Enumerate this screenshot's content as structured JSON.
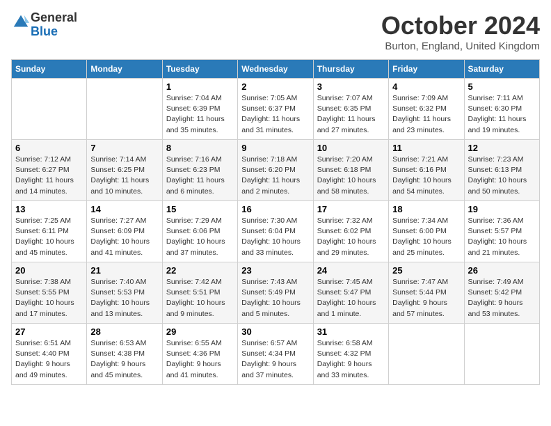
{
  "header": {
    "logo_line1": "General",
    "logo_line2": "Blue",
    "month": "October 2024",
    "location": "Burton, England, United Kingdom"
  },
  "days_of_week": [
    "Sunday",
    "Monday",
    "Tuesday",
    "Wednesday",
    "Thursday",
    "Friday",
    "Saturday"
  ],
  "weeks": [
    [
      {
        "day": "",
        "info": ""
      },
      {
        "day": "",
        "info": ""
      },
      {
        "day": "1",
        "info": "Sunrise: 7:04 AM\nSunset: 6:39 PM\nDaylight: 11 hours and 35 minutes."
      },
      {
        "day": "2",
        "info": "Sunrise: 7:05 AM\nSunset: 6:37 PM\nDaylight: 11 hours and 31 minutes."
      },
      {
        "day": "3",
        "info": "Sunrise: 7:07 AM\nSunset: 6:35 PM\nDaylight: 11 hours and 27 minutes."
      },
      {
        "day": "4",
        "info": "Sunrise: 7:09 AM\nSunset: 6:32 PM\nDaylight: 11 hours and 23 minutes."
      },
      {
        "day": "5",
        "info": "Sunrise: 7:11 AM\nSunset: 6:30 PM\nDaylight: 11 hours and 19 minutes."
      }
    ],
    [
      {
        "day": "6",
        "info": "Sunrise: 7:12 AM\nSunset: 6:27 PM\nDaylight: 11 hours and 14 minutes."
      },
      {
        "day": "7",
        "info": "Sunrise: 7:14 AM\nSunset: 6:25 PM\nDaylight: 11 hours and 10 minutes."
      },
      {
        "day": "8",
        "info": "Sunrise: 7:16 AM\nSunset: 6:23 PM\nDaylight: 11 hours and 6 minutes."
      },
      {
        "day": "9",
        "info": "Sunrise: 7:18 AM\nSunset: 6:20 PM\nDaylight: 11 hours and 2 minutes."
      },
      {
        "day": "10",
        "info": "Sunrise: 7:20 AM\nSunset: 6:18 PM\nDaylight: 10 hours and 58 minutes."
      },
      {
        "day": "11",
        "info": "Sunrise: 7:21 AM\nSunset: 6:16 PM\nDaylight: 10 hours and 54 minutes."
      },
      {
        "day": "12",
        "info": "Sunrise: 7:23 AM\nSunset: 6:13 PM\nDaylight: 10 hours and 50 minutes."
      }
    ],
    [
      {
        "day": "13",
        "info": "Sunrise: 7:25 AM\nSunset: 6:11 PM\nDaylight: 10 hours and 45 minutes."
      },
      {
        "day": "14",
        "info": "Sunrise: 7:27 AM\nSunset: 6:09 PM\nDaylight: 10 hours and 41 minutes."
      },
      {
        "day": "15",
        "info": "Sunrise: 7:29 AM\nSunset: 6:06 PM\nDaylight: 10 hours and 37 minutes."
      },
      {
        "day": "16",
        "info": "Sunrise: 7:30 AM\nSunset: 6:04 PM\nDaylight: 10 hours and 33 minutes."
      },
      {
        "day": "17",
        "info": "Sunrise: 7:32 AM\nSunset: 6:02 PM\nDaylight: 10 hours and 29 minutes."
      },
      {
        "day": "18",
        "info": "Sunrise: 7:34 AM\nSunset: 6:00 PM\nDaylight: 10 hours and 25 minutes."
      },
      {
        "day": "19",
        "info": "Sunrise: 7:36 AM\nSunset: 5:57 PM\nDaylight: 10 hours and 21 minutes."
      }
    ],
    [
      {
        "day": "20",
        "info": "Sunrise: 7:38 AM\nSunset: 5:55 PM\nDaylight: 10 hours and 17 minutes."
      },
      {
        "day": "21",
        "info": "Sunrise: 7:40 AM\nSunset: 5:53 PM\nDaylight: 10 hours and 13 minutes."
      },
      {
        "day": "22",
        "info": "Sunrise: 7:42 AM\nSunset: 5:51 PM\nDaylight: 10 hours and 9 minutes."
      },
      {
        "day": "23",
        "info": "Sunrise: 7:43 AM\nSunset: 5:49 PM\nDaylight: 10 hours and 5 minutes."
      },
      {
        "day": "24",
        "info": "Sunrise: 7:45 AM\nSunset: 5:47 PM\nDaylight: 10 hours and 1 minute."
      },
      {
        "day": "25",
        "info": "Sunrise: 7:47 AM\nSunset: 5:44 PM\nDaylight: 9 hours and 57 minutes."
      },
      {
        "day": "26",
        "info": "Sunrise: 7:49 AM\nSunset: 5:42 PM\nDaylight: 9 hours and 53 minutes."
      }
    ],
    [
      {
        "day": "27",
        "info": "Sunrise: 6:51 AM\nSunset: 4:40 PM\nDaylight: 9 hours and 49 minutes."
      },
      {
        "day": "28",
        "info": "Sunrise: 6:53 AM\nSunset: 4:38 PM\nDaylight: 9 hours and 45 minutes."
      },
      {
        "day": "29",
        "info": "Sunrise: 6:55 AM\nSunset: 4:36 PM\nDaylight: 9 hours and 41 minutes."
      },
      {
        "day": "30",
        "info": "Sunrise: 6:57 AM\nSunset: 4:34 PM\nDaylight: 9 hours and 37 minutes."
      },
      {
        "day": "31",
        "info": "Sunrise: 6:58 AM\nSunset: 4:32 PM\nDaylight: 9 hours and 33 minutes."
      },
      {
        "day": "",
        "info": ""
      },
      {
        "day": "",
        "info": ""
      }
    ]
  ]
}
